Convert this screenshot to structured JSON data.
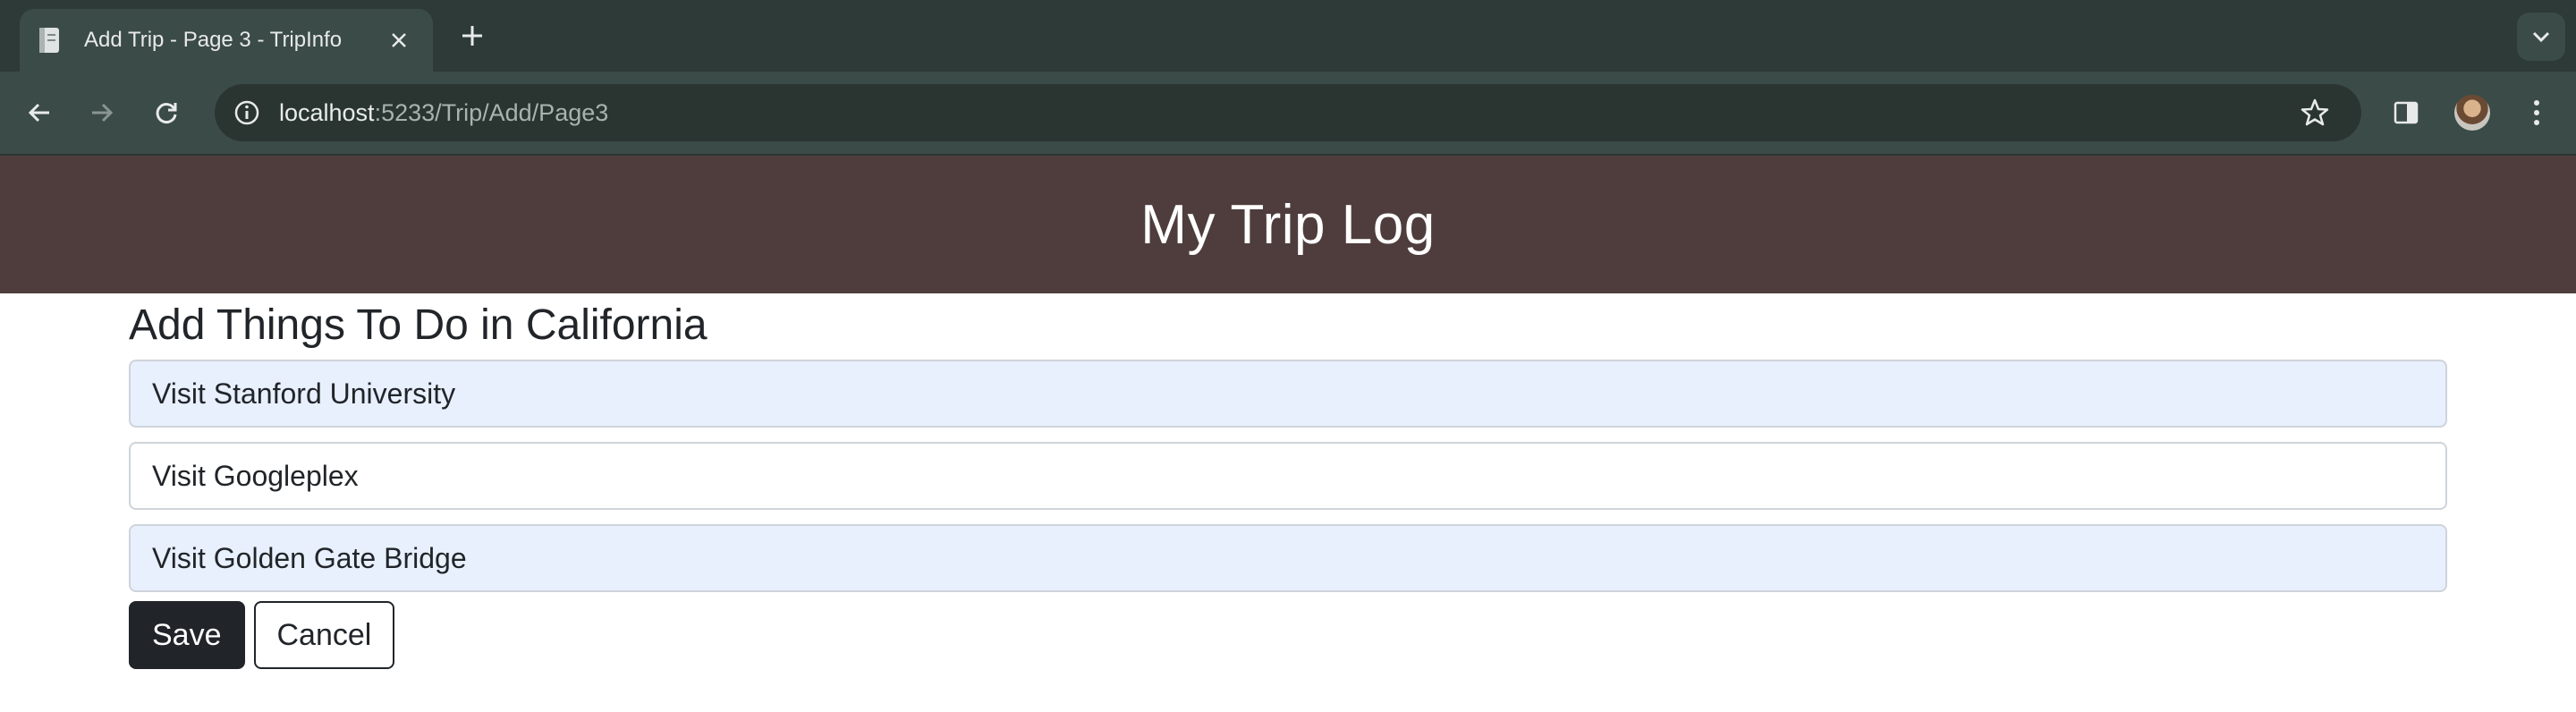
{
  "browser": {
    "tab_title": "Add Trip - Page 3 - TripInfo",
    "url_host": "localhost",
    "url_path": ":5233/Trip/Add/Page3"
  },
  "header": {
    "title": "My Trip Log"
  },
  "main": {
    "heading": "Add Things To Do in California",
    "fields": [
      {
        "value": "Visit Stanford University"
      },
      {
        "value": "Visit Googleplex"
      },
      {
        "value": "Visit Golden Gate Bridge"
      }
    ],
    "save_label": "Save",
    "cancel_label": "Cancel"
  },
  "colors": {
    "header_bg": "#4f3d3d",
    "browser_frame": "#2d3a37",
    "autofill_bg": "#e8f0fe",
    "button_dark": "#212529"
  }
}
